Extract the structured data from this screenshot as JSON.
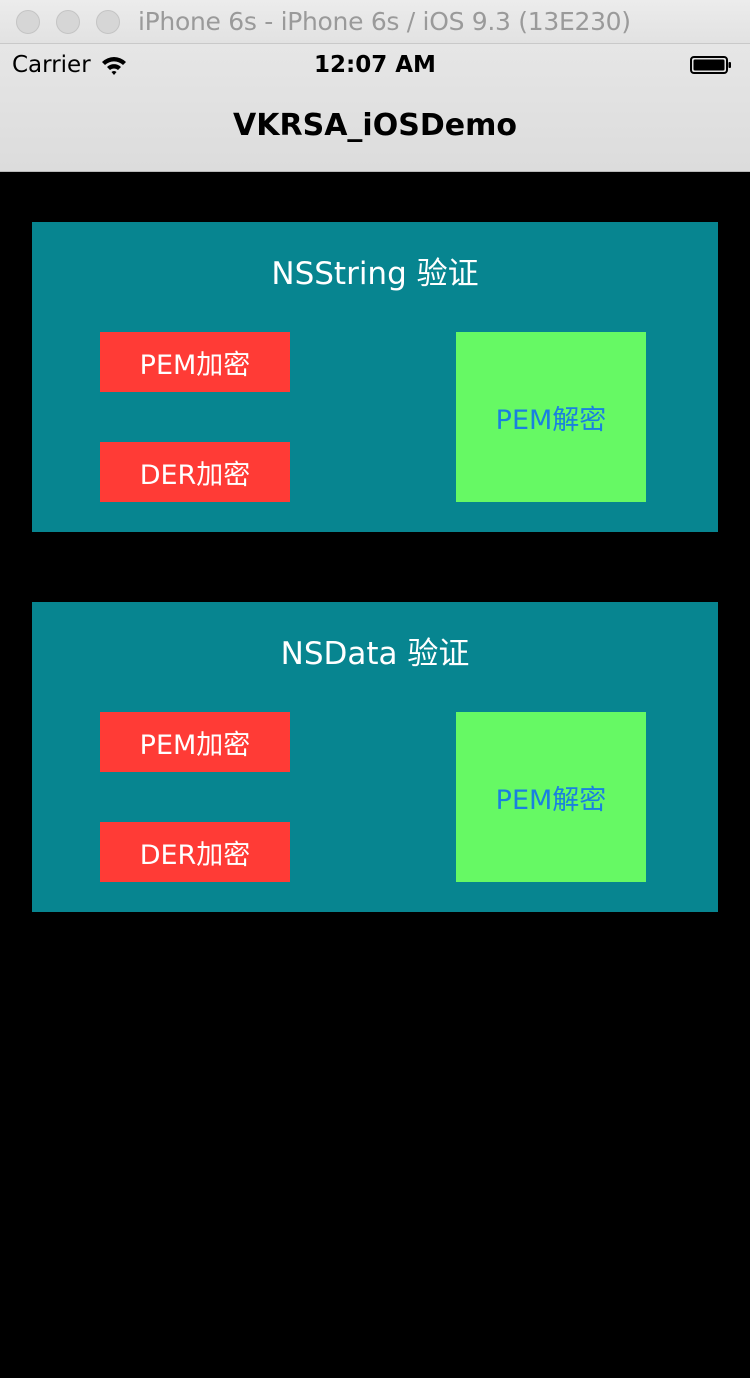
{
  "window": {
    "title": "iPhone 6s - iPhone 6s / iOS 9.3 (13E230)"
  },
  "status_bar": {
    "carrier": "Carrier",
    "time": "12:07 AM"
  },
  "nav": {
    "title": "VKRSA_iOSDemo"
  },
  "sections": [
    {
      "title": "NSString 验证",
      "pem_encrypt_label": "PEM加密",
      "der_encrypt_label": "DER加密",
      "pem_decrypt_label": "PEM解密"
    },
    {
      "title": "NSData 验证",
      "pem_encrypt_label": "PEM加密",
      "der_encrypt_label": "DER加密",
      "pem_decrypt_label": "PEM解密"
    }
  ],
  "colors": {
    "panel": "#078590",
    "encrypt_button": "#ff3b36",
    "decrypt_button": "#66f964",
    "decrypt_text": "#1a7fe0",
    "background": "#000000"
  },
  "icons": {
    "wifi": "wifi-icon",
    "battery": "battery-icon"
  }
}
